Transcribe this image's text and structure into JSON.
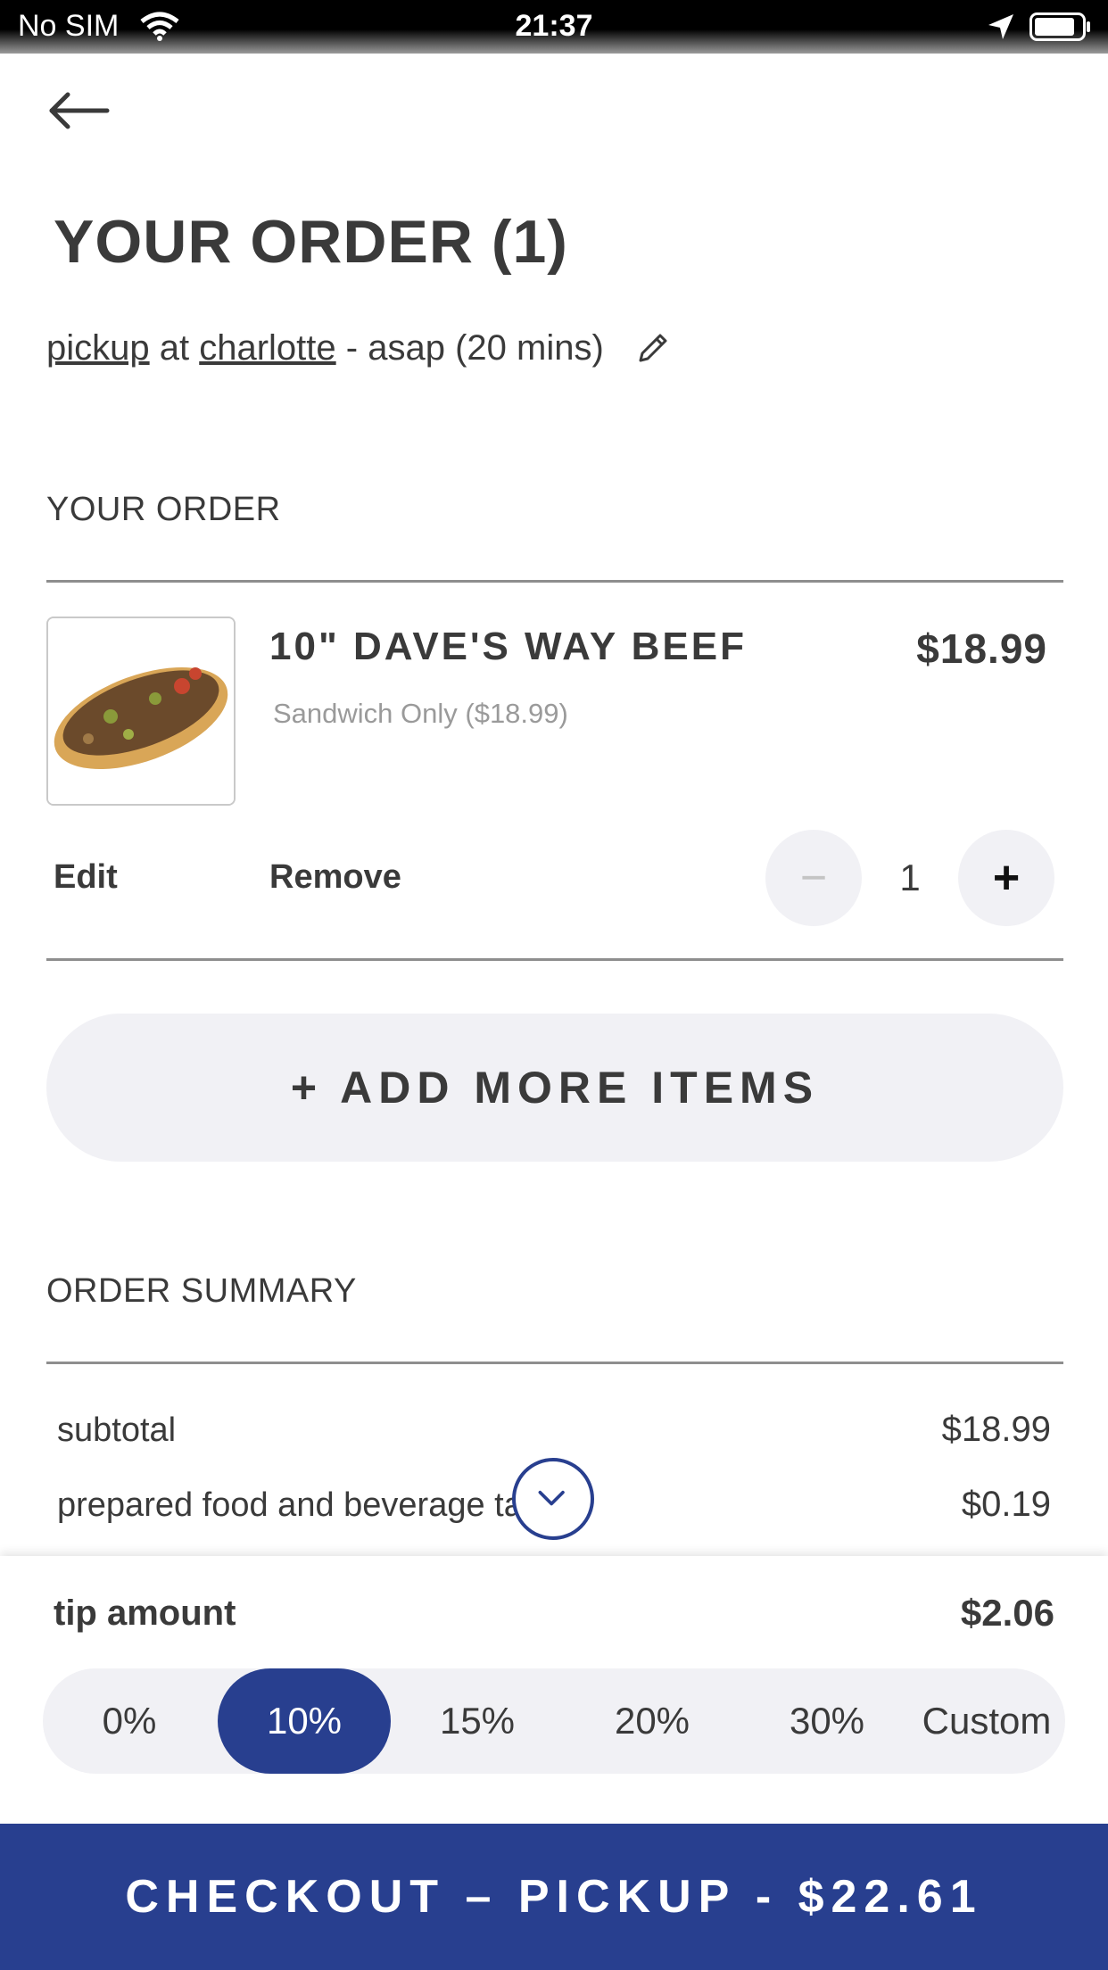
{
  "status_bar": {
    "carrier": "No SIM",
    "time": "21:37"
  },
  "header": {
    "title": "YOUR ORDER (1)"
  },
  "pickup": {
    "mode": "pickup",
    "at": "at",
    "location": "charlotte",
    "time": "- asap (20 mins)"
  },
  "order_section": {
    "label": "YOUR ORDER",
    "items": [
      {
        "name": "10\" DAVE'S WAY BEEF",
        "price": "$18.99",
        "variant": "Sandwich Only ($18.99)",
        "edit_label": "Edit",
        "remove_label": "Remove",
        "quantity": "1",
        "minus": "−",
        "plus": "+"
      }
    ],
    "add_more_label": "+ ADD MORE ITEMS"
  },
  "summary": {
    "label": "ORDER SUMMARY",
    "rows": [
      {
        "label": "subtotal",
        "value": "$18.99"
      },
      {
        "label": "prepared food and beverage ta",
        "value": "$0.19"
      }
    ]
  },
  "tip": {
    "label": "tip amount",
    "value": "$2.06",
    "options": [
      "0%",
      "10%",
      "15%",
      "20%",
      "30%",
      "Custom"
    ],
    "selected": "10%"
  },
  "checkout": {
    "label": "CHECKOUT – PICKUP - $22.61"
  },
  "colors": {
    "accent": "#283f8f",
    "pill_bg": "#f1f1f5",
    "text": "#3a3a3a"
  }
}
